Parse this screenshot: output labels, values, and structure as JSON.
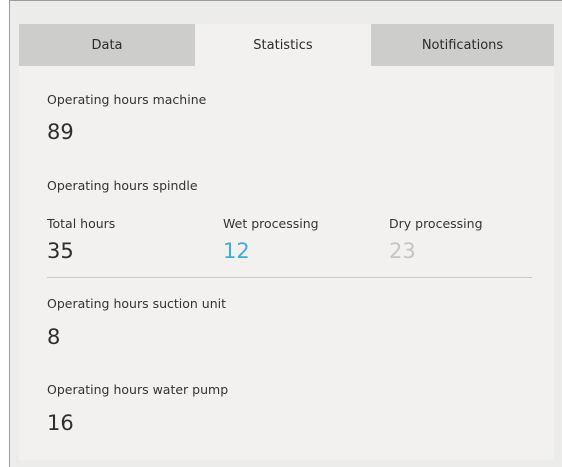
{
  "tabs": [
    {
      "label": "Data",
      "active": false
    },
    {
      "label": "Statistics",
      "active": true
    },
    {
      "label": "Notifications",
      "active": false
    }
  ],
  "machine": {
    "label": "Operating hours machine",
    "value": "89"
  },
  "spindle": {
    "label": "Operating hours spindle",
    "total": {
      "label": "Total hours",
      "value": "35"
    },
    "wet": {
      "label": "Wet processing",
      "value": "12"
    },
    "dry": {
      "label": "Dry processing",
      "value": "23"
    }
  },
  "suction": {
    "label": "Operating hours suction unit",
    "value": "8"
  },
  "pump": {
    "label": "Operating hours water pump",
    "value": "16"
  },
  "colors": {
    "active_tab_bg": "#f2f1f0",
    "inactive_tab_bg": "#cdcdcc",
    "wet_value": "#3aaee0",
    "dry_value": "#c4c4c4"
  }
}
